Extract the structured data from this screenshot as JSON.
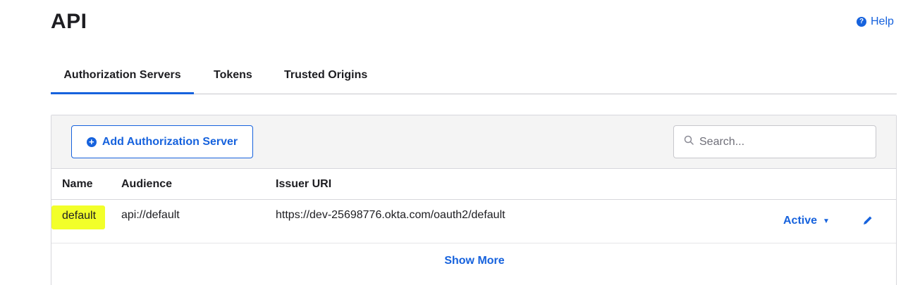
{
  "page": {
    "title": "API",
    "help_label": "Help"
  },
  "tabs": [
    {
      "label": "Authorization Servers",
      "active": true
    },
    {
      "label": "Tokens",
      "active": false
    },
    {
      "label": "Trusted Origins",
      "active": false
    }
  ],
  "toolbar": {
    "add_button_label": "Add Authorization Server",
    "search_placeholder": "Search...",
    "search_value": ""
  },
  "table": {
    "columns": [
      "Name",
      "Audience",
      "Issuer URI"
    ],
    "rows": [
      {
        "name": "default",
        "audience": "api://default",
        "issuer_uri": "https://dev-25698776.okta.com/oauth2/default",
        "status": "Active"
      }
    ],
    "show_more_label": "Show More"
  },
  "colors": {
    "accent": "#1662dd",
    "highlight": "#f2ff2a",
    "toolbar_bg": "#f4f4f4"
  },
  "icons": [
    "help-icon",
    "plus-circle-icon",
    "search-icon",
    "caret-down-icon",
    "pencil-icon"
  ]
}
